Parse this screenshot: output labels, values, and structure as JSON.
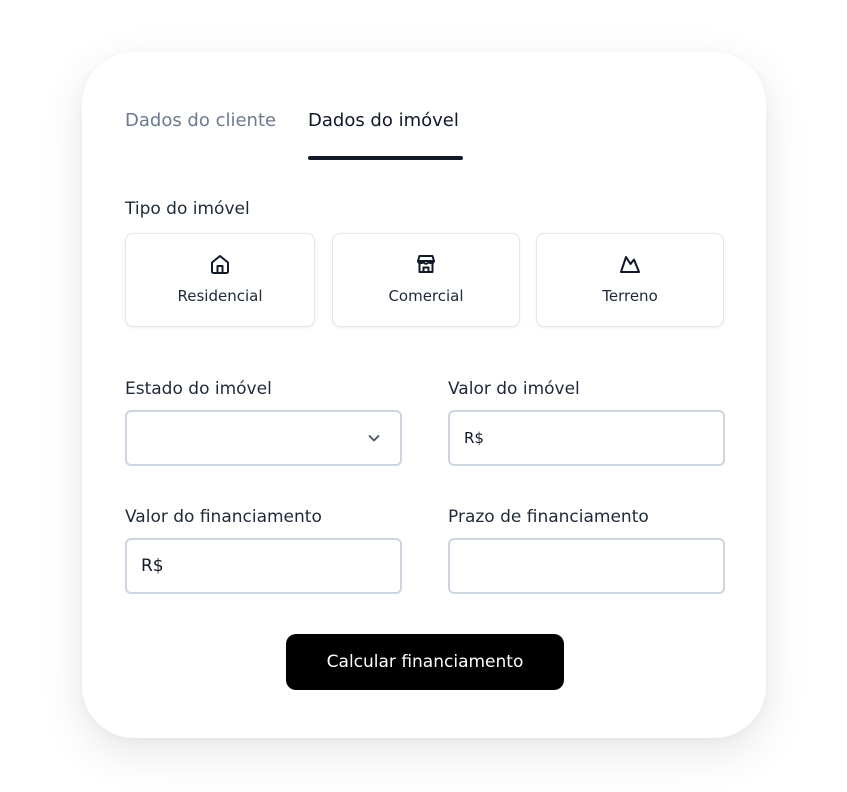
{
  "tabs": [
    {
      "label": "Dados do cliente",
      "active": false
    },
    {
      "label": "Dados do imóvel",
      "active": true
    }
  ],
  "property_type": {
    "label": "Tipo do imóvel",
    "options": [
      {
        "label": "Residencial",
        "icon": "house-icon"
      },
      {
        "label": "Comercial",
        "icon": "store-icon"
      },
      {
        "label": "Terreno",
        "icon": "land-icon"
      }
    ]
  },
  "fields": {
    "estado": {
      "label": "Estado do imóvel",
      "value": ""
    },
    "valor_imovel": {
      "label": "Valor do imóvel",
      "prefix": "R$"
    },
    "valor_financiamento": {
      "label": "Valor do financiamento",
      "prefix": "R$"
    },
    "prazo": {
      "label": "Prazo de financiamento",
      "value": ""
    }
  },
  "submit_label": "Calcular financiamento",
  "colors": {
    "accent": "#000000",
    "tab_inactive": "#6b7a8f",
    "border": "#cdd6e0"
  }
}
